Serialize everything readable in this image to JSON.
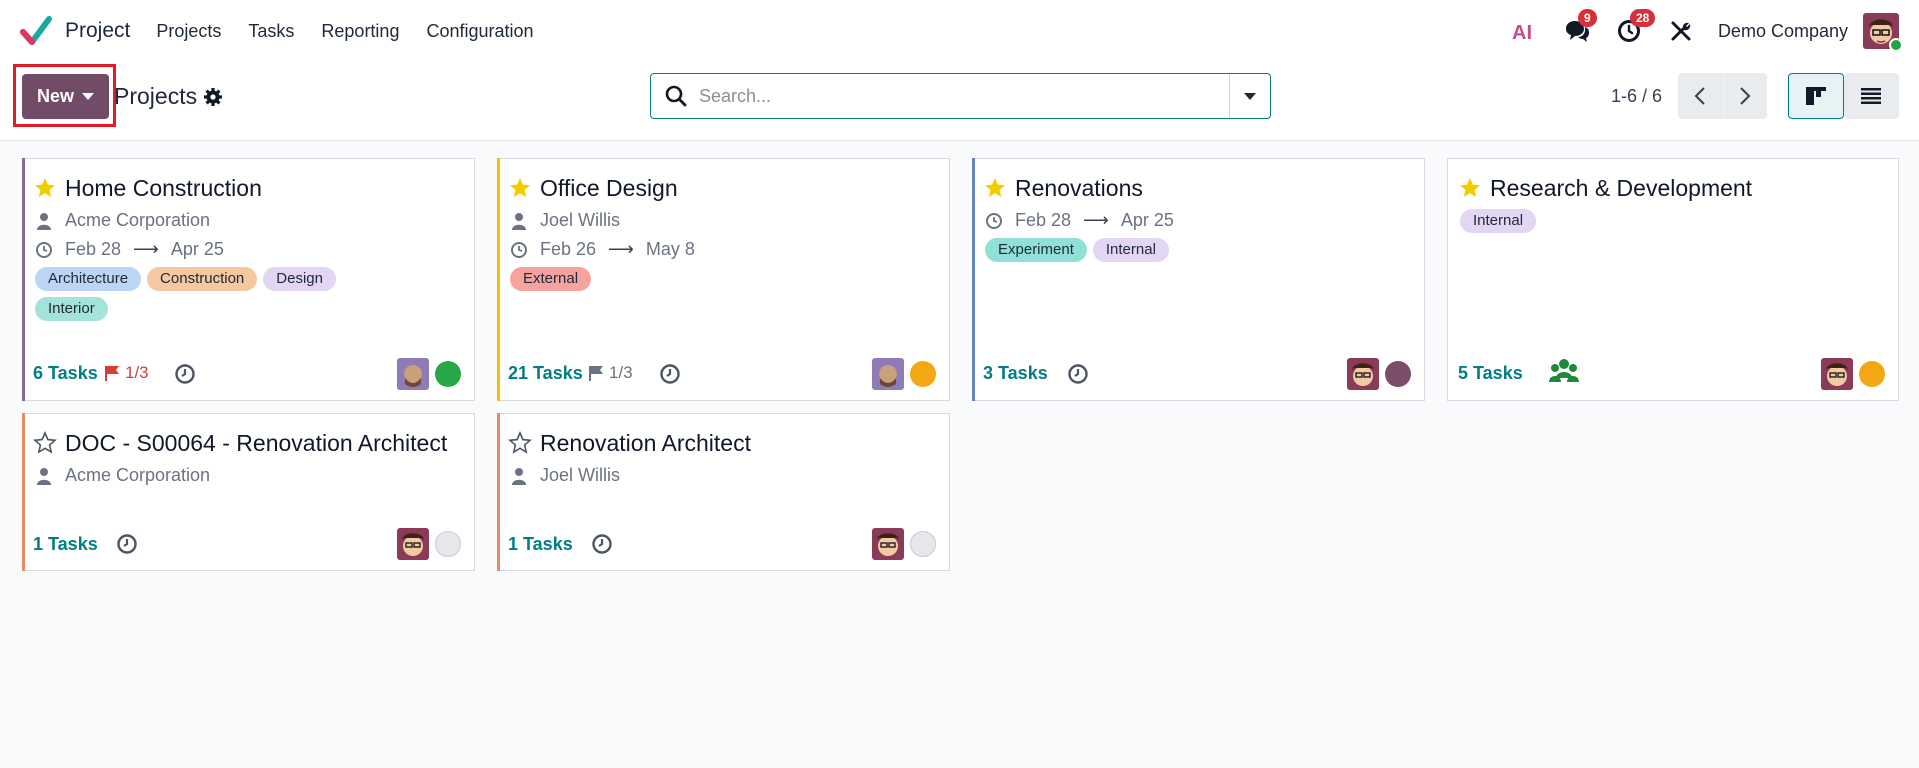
{
  "app": {
    "name": "Project",
    "menu": [
      "Projects",
      "Tasks",
      "Reporting",
      "Configuration"
    ],
    "company": "Demo Company",
    "badges": {
      "messages": "9",
      "activities": "28"
    },
    "ai_label": "AI"
  },
  "control": {
    "new_label": "New",
    "title": "Projects",
    "search_placeholder": "Search...",
    "pager": "1-6 / 6"
  },
  "colors": {
    "brand": "#714b67",
    "teal": "#017e84",
    "star": "#f3cc00"
  },
  "cards": [
    {
      "title": "Home Construction",
      "favorite": true,
      "customer": "Acme Corporation",
      "date_start": "Feb 28",
      "date_end": "Apr 25",
      "tags": [
        "Architecture",
        "Construction",
        "Design",
        "Interior"
      ],
      "tasks_label": "6 Tasks",
      "milestones": "1/3",
      "status": "green"
    },
    {
      "title": "Office Design",
      "favorite": true,
      "customer": "Joel Willis",
      "date_start": "Feb 26",
      "date_end": "May 8",
      "tags": [
        "External"
      ],
      "tasks_label": "21 Tasks",
      "milestones": "1/3",
      "status": "orange"
    },
    {
      "title": "Renovations",
      "favorite": true,
      "date_start": "Feb 28",
      "date_end": "Apr 25",
      "tags": [
        "Experiment",
        "Internal"
      ],
      "tasks_label": "3 Tasks",
      "status": "purple"
    },
    {
      "title": "Research & Development",
      "favorite": true,
      "tags": [
        "Internal"
      ],
      "tasks_label": "5 Tasks",
      "status": "orange"
    },
    {
      "title": "DOC - S00064 - Renovation Architect",
      "favorite": false,
      "customer": "Acme Corporation",
      "tasks_label": "1 Tasks",
      "status": "grey"
    },
    {
      "title": "Renovation Architect",
      "favorite": false,
      "customer": "Joel Willis",
      "tasks_label": "1 Tasks",
      "status": "grey"
    }
  ]
}
